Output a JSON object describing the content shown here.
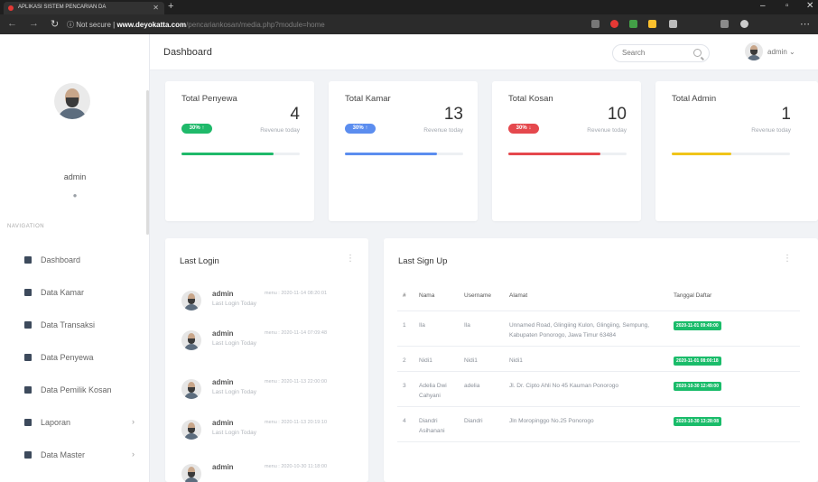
{
  "browser": {
    "tab_title": "APLIKASI SISTEM PENCARIAN DA",
    "url_secure_label": "Not secure",
    "url_domain": "www.deyokatta.com",
    "url_path": "/pencariankosan/media.php?module=home"
  },
  "sidebar": {
    "username": "admin",
    "status_dot": "●",
    "section_label": "NAVIGATION",
    "items": [
      {
        "label": "Dashboard",
        "has_chevron": false
      },
      {
        "label": "Data Kamar",
        "has_chevron": false
      },
      {
        "label": "Data Transaksi",
        "has_chevron": false
      },
      {
        "label": "Data Penyewa",
        "has_chevron": false
      },
      {
        "label": "Data Pemilik Kosan",
        "has_chevron": false
      },
      {
        "label": "Laporan",
        "has_chevron": true
      },
      {
        "label": "Data Master",
        "has_chevron": true
      }
    ]
  },
  "header": {
    "title": "Dashboard",
    "search_placeholder": "Search",
    "user": "admin"
  },
  "cards": [
    {
      "title": "Total Penyewa",
      "value": "4",
      "pill": "30% ↑",
      "sub": "Revenue today",
      "color": "#1fb96a",
      "progress": 0.78
    },
    {
      "title": "Total Kamar",
      "value": "13",
      "pill": "30% ↑",
      "sub": "Revenue today",
      "color": "#5b8def",
      "progress": 0.78
    },
    {
      "title": "Total Kosan",
      "value": "10",
      "pill": "30% ↓",
      "sub": "Revenue today",
      "color": "#e5484d",
      "progress": 0.78
    },
    {
      "title": "Total Admin",
      "value": "1",
      "pill": "",
      "sub": "Revenue today",
      "color": "#f0c419",
      "progress": 0.5
    }
  ],
  "last_login": {
    "title": "Last Login",
    "rows": [
      {
        "name": "admin",
        "time": "menu : 2020-11-14 08:20:01",
        "desc": "Last Login Today"
      },
      {
        "name": "admin",
        "time": "menu : 2020-11-14 07:09:48",
        "desc": "Last Login Today"
      },
      {
        "name": "admin",
        "time": "menu : 2020-11-13 22:00:00",
        "desc": "Last Login Today"
      },
      {
        "name": "admin",
        "time": "menu : 2020-11-13 20:19:10",
        "desc": "Last Login Today"
      },
      {
        "name": "admin",
        "time": "menu : 2020-10-30 11:18:00",
        "desc": "Last Login Today"
      }
    ]
  },
  "last_signup": {
    "title": "Last Sign Up",
    "headers": [
      "#",
      "Nama",
      "Username",
      "Alamat",
      "Tanggal Daftar"
    ],
    "rows": [
      {
        "no": "1",
        "nama": "Ila",
        "username": "Ila",
        "alamat": "Unnamed Road, Glingiing Kulon, Glingiing, Sempung, Kabupaten Ponorogo, Jawa Timur 63484",
        "tanggal": "2020-11-01 09:49:00"
      },
      {
        "no": "2",
        "nama": "Nidi1",
        "username": "Nidi1",
        "alamat": "Nidi1",
        "tanggal": "2020-11-01 08:00:18"
      },
      {
        "no": "3",
        "nama": "Adelia Dwi Cahyani",
        "username": "adelia",
        "alamat": "Jl. Dr. Cipto Ahli No 45 Kauman Ponorogo",
        "tanggal": "2020-10-30 12:49:00"
      },
      {
        "no": "4",
        "nama": "Diandri Asihanani",
        "username": "Diandri",
        "alamat": "Jln Moropinggo No.25 Ponorogo",
        "tanggal": "2020-10-30 13:28:08"
      }
    ]
  }
}
